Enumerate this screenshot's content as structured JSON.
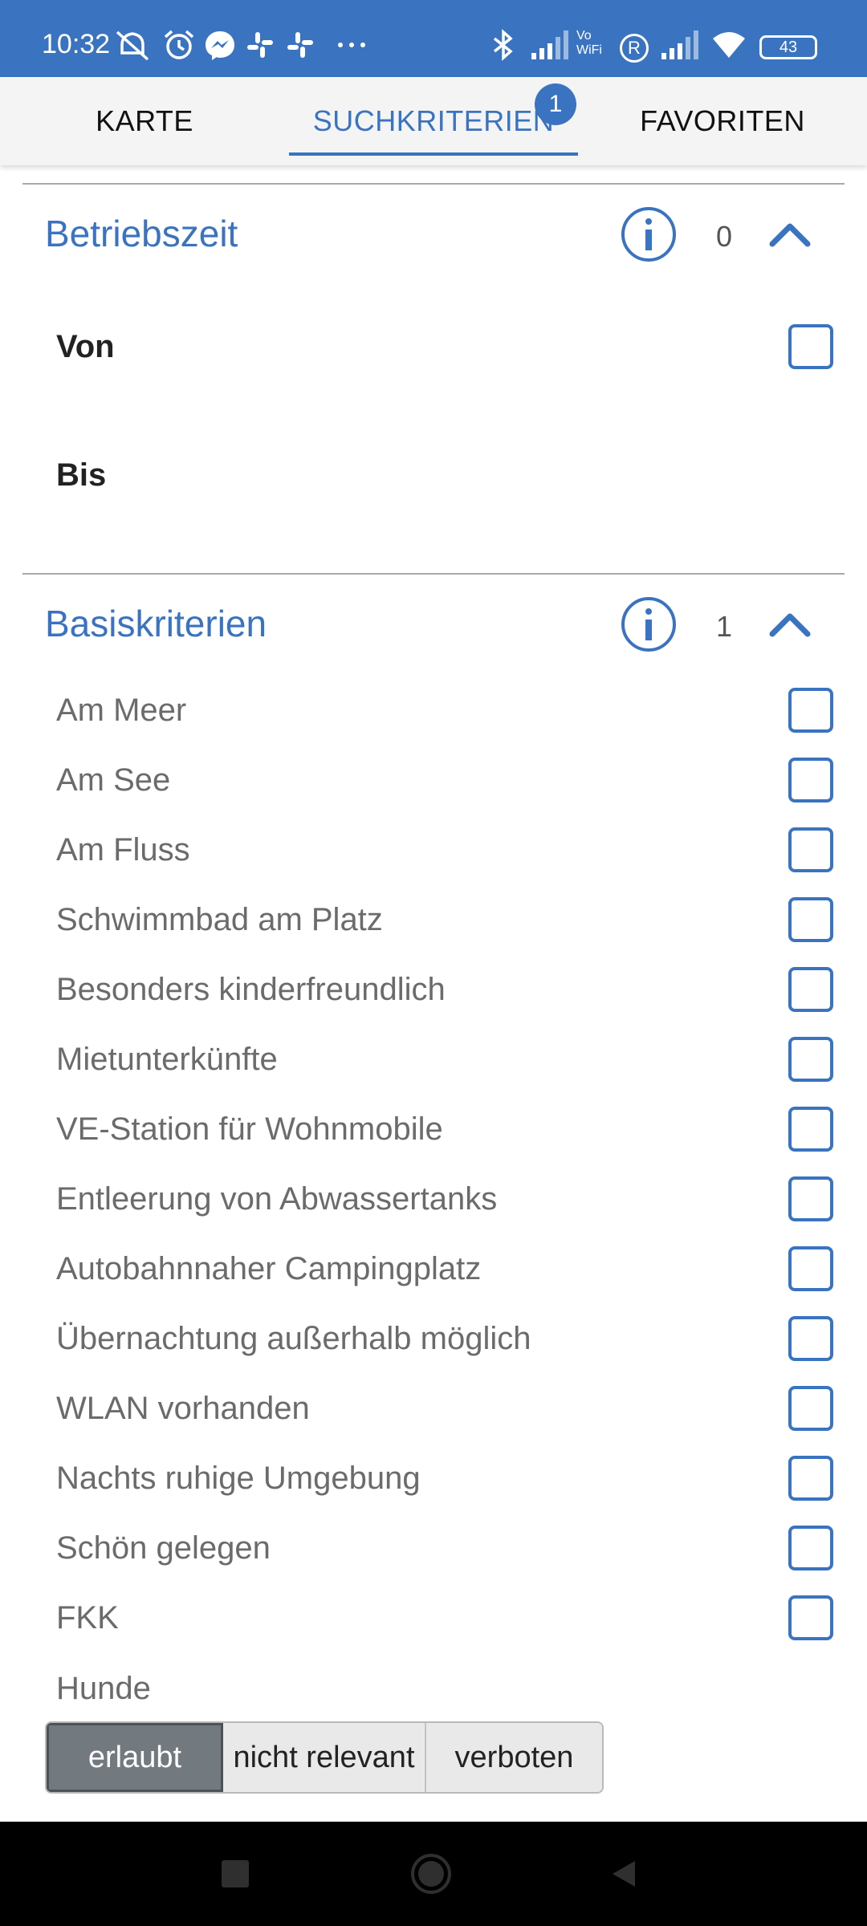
{
  "status_bar": {
    "time": "10:32",
    "battery": "43",
    "icons": [
      "mute-icon",
      "alarm-icon",
      "messenger-icon",
      "slack-icon",
      "slack-icon",
      "more-icon",
      "bluetooth-icon",
      "signal-icon",
      "vowifi-icon",
      "roaming-icon",
      "signal-icon",
      "wifi-icon",
      "battery-icon"
    ],
    "vowifi_text": "Vo WiFi",
    "roaming_text": "R"
  },
  "tabs": [
    {
      "label": "KARTE",
      "active": false
    },
    {
      "label": "SUCHKRITERIEN",
      "active": true,
      "badge": "1"
    },
    {
      "label": "FAVORITEN",
      "active": false
    }
  ],
  "sections": {
    "betriebszeit": {
      "title": "Betriebszeit",
      "count": "0",
      "fields": {
        "von": "Von",
        "bis": "Bis"
      }
    },
    "basiskriterien": {
      "title": "Basiskriterien",
      "count": "1",
      "items": [
        {
          "label": "Am Meer",
          "checked": false
        },
        {
          "label": "Am See",
          "checked": false
        },
        {
          "label": "Am Fluss",
          "checked": false
        },
        {
          "label": "Schwimmbad am Platz",
          "checked": false
        },
        {
          "label": "Besonders kinderfreundlich",
          "checked": false
        },
        {
          "label": "Mietunterkünfte",
          "checked": false
        },
        {
          "label": "VE-Station für Wohnmobile",
          "checked": false
        },
        {
          "label": "Entleerung von Abwassertanks",
          "checked": false
        },
        {
          "label": "Autobahnnaher Campingplatz",
          "checked": false
        },
        {
          "label": "Übernachtung außerhalb möglich",
          "checked": false
        },
        {
          "label": "WLAN vorhanden",
          "checked": false
        },
        {
          "label": "Nachts ruhige Umgebung",
          "checked": false
        },
        {
          "label": "Schön gelegen",
          "checked": false
        },
        {
          "label": "FKK",
          "checked": false
        }
      ],
      "hunde": {
        "label": "Hunde",
        "options": [
          "erlaubt",
          "nicht relevant",
          "verboten"
        ],
        "selected": "erlaubt"
      }
    }
  },
  "colors": {
    "accent": "#3a74c0",
    "text_muted": "#6b6b6b",
    "segment_selected": "#727a80"
  },
  "nav_bar": {
    "icons": [
      "recents-square-icon",
      "home-circle-icon",
      "back-triangle-icon"
    ]
  }
}
